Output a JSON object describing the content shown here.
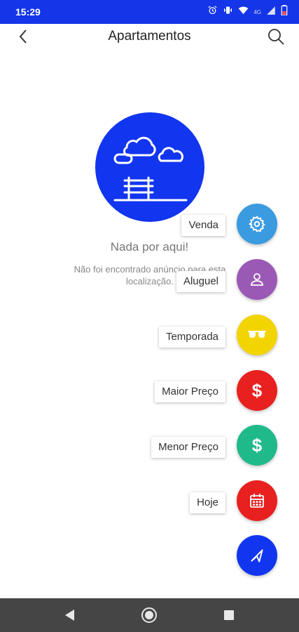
{
  "status_bar": {
    "time": "15:29",
    "network": "4G",
    "icons": [
      "alarm-icon",
      "vibrate-icon",
      "wifi-icon",
      "signal-icon",
      "battery-icon"
    ]
  },
  "app_bar": {
    "title": "Apartamentos",
    "back_icon": "arrow-back-icon",
    "search_icon": "search-icon"
  },
  "empty_state": {
    "illustration": "park-bench-clouds-icon",
    "title": "Nada por aqui!",
    "message": "Não foi encontrado anúncio para esta localização."
  },
  "fab_menu": {
    "items": [
      {
        "label": "Venda",
        "icon": "gear-icon",
        "color": "#3b9be0"
      },
      {
        "label": "Aluguel",
        "icon": "person-icon",
        "color": "#9b59b6"
      },
      {
        "label": "Temporada",
        "icon": "sunglasses-icon",
        "color": "#f2d400"
      },
      {
        "label": "Maior Preço",
        "icon": "dollar-icon",
        "color": "#e8201f"
      },
      {
        "label": "Menor Preço",
        "icon": "dollar-icon",
        "color": "#20b98a"
      },
      {
        "label": "Hoje",
        "icon": "calendar-icon",
        "color": "#e8201f"
      }
    ],
    "main_fab": {
      "icon": "send-arrow-icon",
      "color": "#1235ef"
    }
  },
  "navigation_bar": {
    "buttons": [
      "back-triangle-icon",
      "home-circle-icon",
      "recents-square-icon"
    ]
  }
}
